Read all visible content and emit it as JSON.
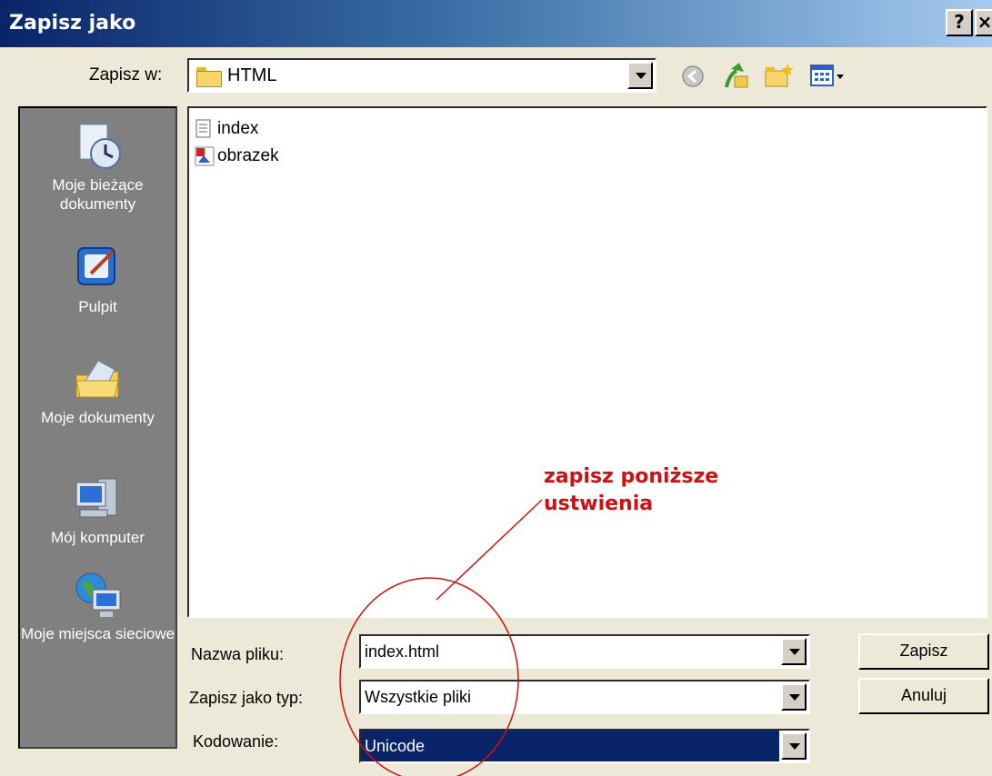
{
  "window": {
    "title": "Zapisz jako",
    "help_label": "?",
    "close_label": "×"
  },
  "toolbar": {
    "save_in_label": "Zapisz w:",
    "save_in_value": "HTML",
    "icons": [
      "back-icon",
      "up-folder-icon",
      "new-folder-icon",
      "view-menu-icon"
    ]
  },
  "places": [
    {
      "label": "Moje bieżące dokumenty",
      "icon": "recent-documents-icon"
    },
    {
      "label": "Pulpit",
      "icon": "desktop-icon"
    },
    {
      "label": "Moje dokumenty",
      "icon": "my-documents-icon"
    },
    {
      "label": "Mój komputer",
      "icon": "my-computer-icon"
    },
    {
      "label": "Moje miejsca sieciowe",
      "icon": "network-places-icon"
    }
  ],
  "files": [
    {
      "name": "index",
      "icon": "text-file-icon"
    },
    {
      "name": "obrazek",
      "icon": "image-file-icon"
    }
  ],
  "form": {
    "filename_label": "Nazwa pliku:",
    "filename_value": "index.html",
    "type_label": "Zapisz jako typ:",
    "type_value": "Wszystkie pliki",
    "encoding_label": "Kodowanie:",
    "encoding_value": "Unicode"
  },
  "buttons": {
    "save": "Zapisz",
    "cancel": "Anuluj"
  },
  "annotation": {
    "line1": "zapisz poniższe",
    "line2": "ustwienia",
    "color": "#d01010"
  },
  "colors": {
    "title_bar": "#0a246a",
    "selection": "#0a246a",
    "places_bg": "#808080",
    "dialog_bg": "#ece9d8"
  }
}
